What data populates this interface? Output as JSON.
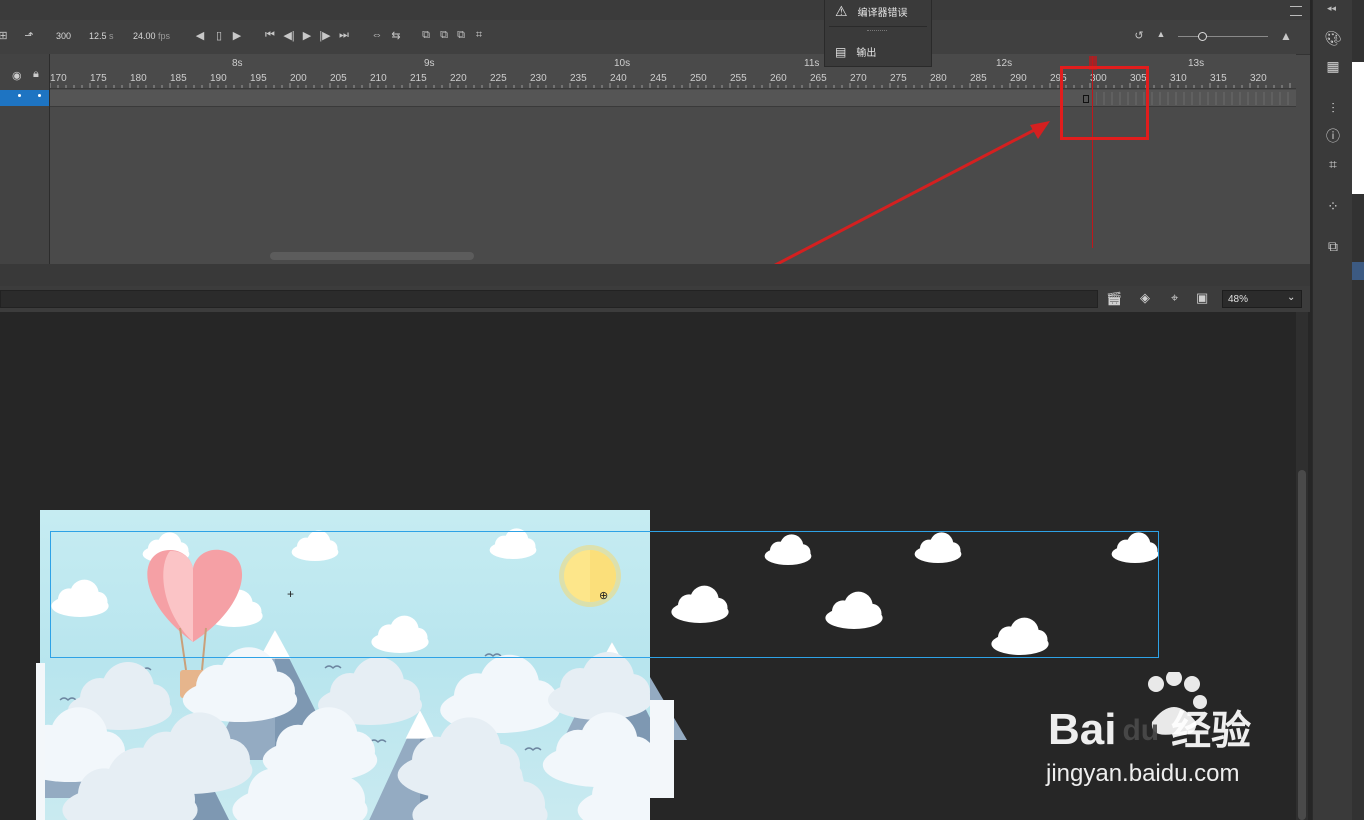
{
  "timeline": {
    "frame_count": "300",
    "elapsed_value": "12.5",
    "elapsed_unit": "s",
    "fps_value": "24.00",
    "fps_unit": "fps",
    "seconds_labels": [
      "8s",
      "9s",
      "10s",
      "11s",
      "12s",
      "13s"
    ],
    "frame_labels": [
      "170",
      "175",
      "180",
      "185",
      "190",
      "195",
      "200",
      "205",
      "210",
      "215",
      "220",
      "225",
      "230",
      "235",
      "240",
      "245",
      "250",
      "255",
      "260",
      "265",
      "270",
      "275",
      "280",
      "285",
      "290",
      "295",
      "300",
      "305",
      "310",
      "315",
      "320"
    ]
  },
  "popup": {
    "compiler_errors_label": "编译器错误",
    "output_label": "输出"
  },
  "stage_toolbar": {
    "zoom_value": "48%"
  },
  "watermark": {
    "logo_text_baidu": "Bai",
    "logo_text_du": "du",
    "logo_text_jingyan": "经验",
    "url": "jingyan.baidu.com"
  },
  "colors": {
    "playhead": "#c0171b",
    "annotation_red": "#e11d1d",
    "selection_blue": "#2ea2e6",
    "layer_selected": "#1e74c2"
  }
}
